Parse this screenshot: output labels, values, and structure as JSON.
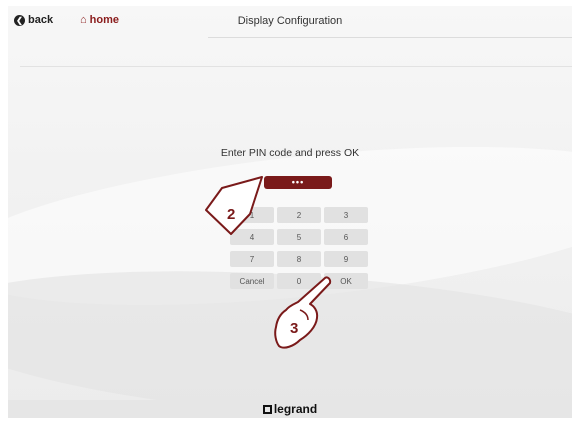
{
  "header": {
    "back_label": "back",
    "home_label": "home",
    "title": "Display Configuration"
  },
  "main": {
    "prompt": "Enter PIN code and press OK",
    "pin_value": "•••",
    "keys": [
      "1",
      "2",
      "3",
      "4",
      "5",
      "6",
      "7",
      "8",
      "9",
      "Cancel",
      "0",
      "OK"
    ]
  },
  "footer": {
    "brand": "legrand"
  },
  "annotations": {
    "callout_2": "2",
    "callout_3": "3"
  },
  "colors": {
    "accent": "#7a1a1a",
    "home": "#8a1c1c",
    "key_bg": "#e1e1e1"
  },
  "icons": {
    "back": "back-arrow-circle-icon",
    "home": "house-icon",
    "finger": "pointing-hand-icon"
  }
}
